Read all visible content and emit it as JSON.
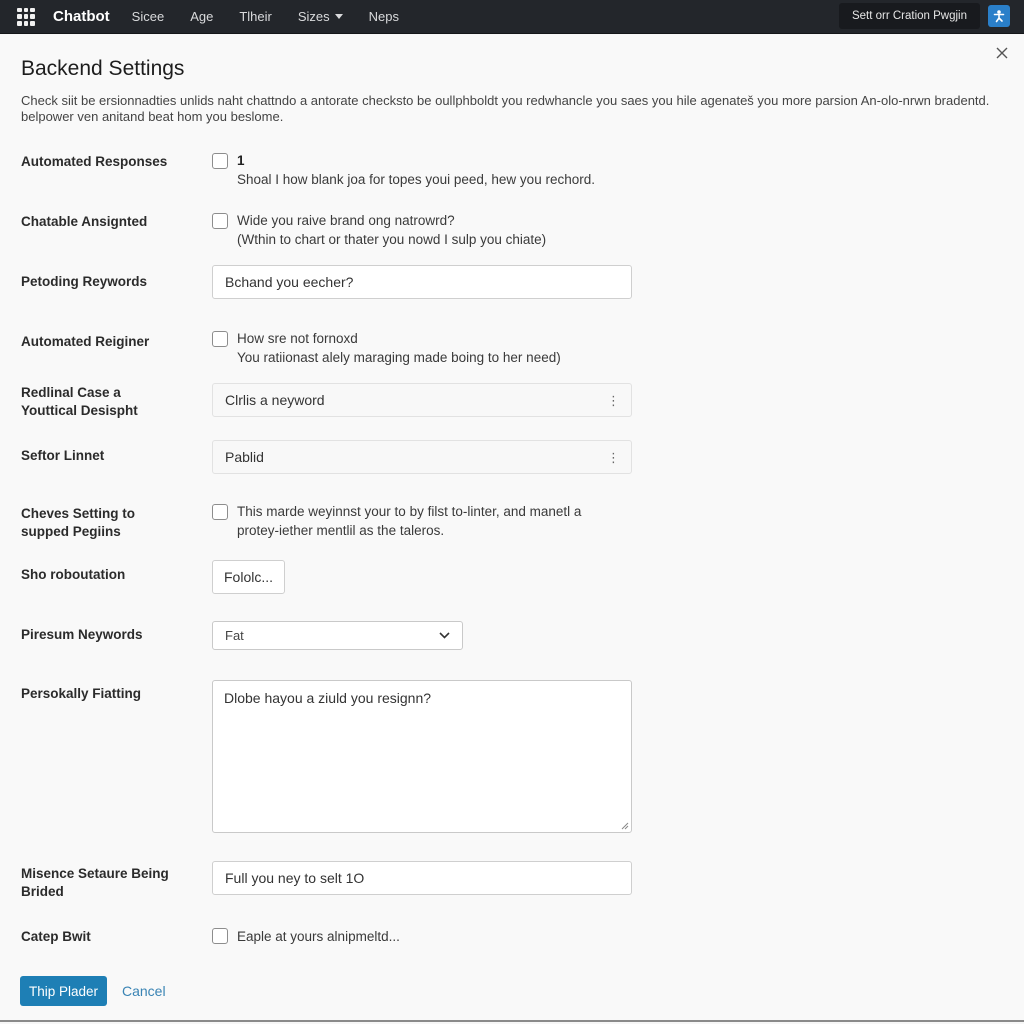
{
  "topbar": {
    "brand": "Chatbot",
    "nav": [
      {
        "label": "Sicee",
        "has_caret": false
      },
      {
        "label": "Age",
        "has_caret": false
      },
      {
        "label": "Tlheir",
        "has_caret": false
      },
      {
        "label": "Sizes",
        "has_caret": true
      },
      {
        "label": "Neps",
        "has_caret": false
      }
    ],
    "plugin_button": "Sett orr Cration Pwgjin",
    "user_icon": "user-accessibility-icon",
    "accent_color": "#2a7fc9"
  },
  "panel": {
    "title": "Backend Settings",
    "description": "Check siit be ersionnadties unlids naht chattndo a antorate checksto be oullphboldt you redwhancle you saes you hile agenateš you more parsion An-olo-nrwn bradentd. belpower ven anitand beat hom you beslome.",
    "close_icon": "close-icon"
  },
  "fields": {
    "automated_responses": {
      "label": "Automated Responses",
      "checked": false,
      "title": "1",
      "help": "Shoal I how blank joa for topes youi peed, hew you rechord."
    },
    "chatable_assigned": {
      "label": "Chatable Ansignted",
      "checked": false,
      "line1": "Wide you raive brand ong natrowrd?",
      "line2": "(Wthin to chart or thater you nowd I sulp you chiate)"
    },
    "petoding_reywords": {
      "label": "Petoding Reywords",
      "value": "Bchand you eecher?"
    },
    "automated_reiginer": {
      "label": "Automated Reiginer",
      "checked": false,
      "line1": "How sre not fornoxd",
      "line2": "You ratiionast alely maraging made boing to her need)"
    },
    "redlinal_case": {
      "label_line1": "Redlinal Case a",
      "label_line2": "Youttical Desispht",
      "value": "Clrlis a neyword"
    },
    "seftor_linnet": {
      "label": "Seftor Linnet",
      "value": "Pablid"
    },
    "cheves_setting": {
      "label_line1": "Cheves Setting to",
      "label_line2": "supped Pegiins",
      "checked": false,
      "line1": "This marde weyinnst your to by filst to-linter, and manetl a",
      "line2": "protey-iether mentlil as the taleros."
    },
    "sho_roboutation": {
      "label": "Sho roboutation",
      "button": "Fololc..."
    },
    "piresum_neywords": {
      "label": "Piresum Neywords",
      "selected": "Fat"
    },
    "personally_fiatting": {
      "label": "Persokally Fiatting",
      "value": "Dlobe hayou a ziuld you resignn?"
    },
    "misence_setaure": {
      "label_line1": "Misence Setaure Being",
      "label_line2": "Brided",
      "value": "Full you ney to selt 1O"
    },
    "catep_bwit": {
      "label": "Catep Bwit",
      "checked": false,
      "text": "Eaple at yours alnipmeltd..."
    }
  },
  "actions": {
    "primary": "Thip Plader",
    "cancel": "Cancel",
    "primary_color": "#1e7fb5"
  }
}
